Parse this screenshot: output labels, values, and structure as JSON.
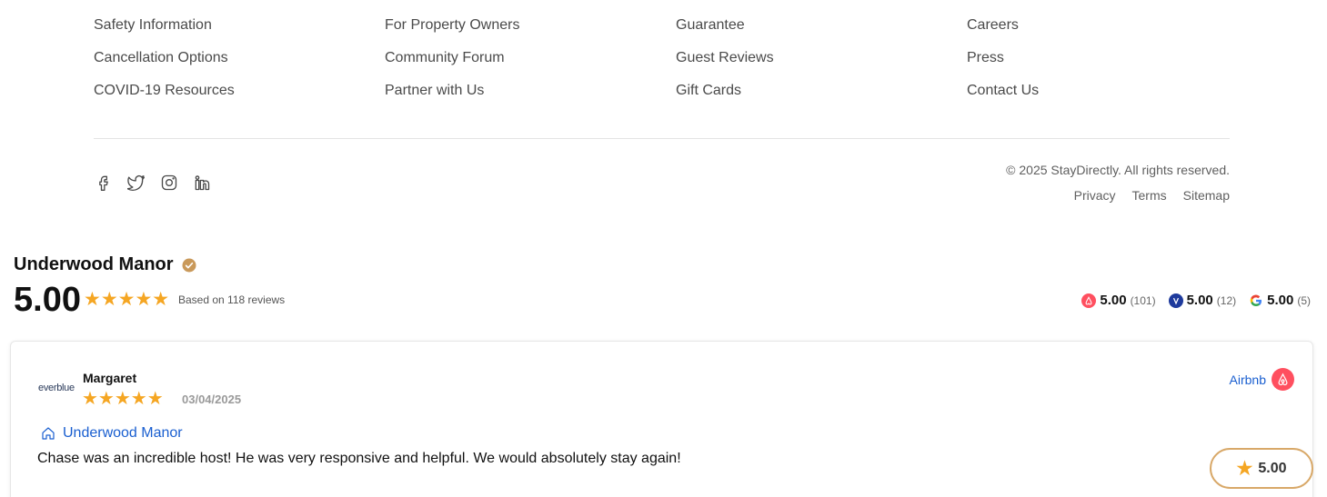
{
  "footer": {
    "columns": [
      {
        "links": [
          "Safety Information",
          "Cancellation Options",
          "COVID-19 Resources"
        ]
      },
      {
        "links": [
          "For Property Owners",
          "Community Forum",
          "Partner with Us"
        ]
      },
      {
        "links": [
          "Guarantee",
          "Guest Reviews",
          "Gift Cards"
        ]
      },
      {
        "links": [
          "Careers",
          "Press",
          "Contact Us"
        ]
      }
    ],
    "social_icons": [
      "facebook-icon",
      "twitter-icon",
      "instagram-icon",
      "linkedin-icon"
    ],
    "copyright": "© 2025 StayDirectly. All rights reserved.",
    "legal": [
      "Privacy",
      "Terms",
      "Sitemap"
    ]
  },
  "reviews": {
    "property_name": "Underwood Manor",
    "overall_score": "5.00",
    "stars": "★★★★★",
    "based_on": "Based on 118 reviews",
    "platforms": [
      {
        "name": "airbnb",
        "score": "5.00",
        "count": "(101)",
        "color": "#ff4f5f"
      },
      {
        "name": "vrbo",
        "score": "5.00",
        "count": "(12)",
        "color": "#1e3a9c"
      },
      {
        "name": "google",
        "score": "5.00",
        "count": "(5)",
        "color": "#4285f4"
      }
    ],
    "review": {
      "brand": "everblue",
      "reviewer": "Margaret",
      "stars": "★★★★★",
      "date": "03/04/2025",
      "source": "Airbnb",
      "property_link": "Underwood Manor",
      "text": "Chase was an incredible host! He was very responsive and helpful. We would absolutely stay again!"
    },
    "rating_pill": "5.00"
  },
  "colors": {
    "star": "#f5a623",
    "link": "#1a5fd0",
    "pill_border": "#d8a868"
  }
}
